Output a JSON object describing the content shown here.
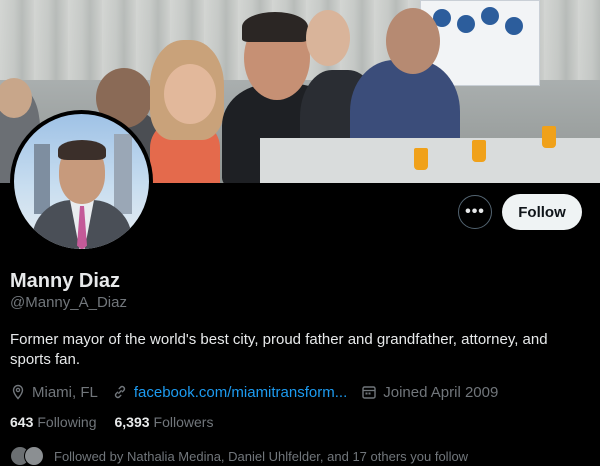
{
  "profile": {
    "name": "Manny Diaz",
    "handle": "@Manny_A_Diaz",
    "bio": "Former mayor of the world's best city, proud father and grandfather, attorney, and sports fan.",
    "location": "Miami, FL",
    "website": "facebook.com/miamitransform...",
    "joined": "Joined April 2009",
    "following_count": "643",
    "following_label": "Following",
    "followers_count": "6,393",
    "followers_label": "Followers",
    "followed_by": "Followed by Nathalia Medina, Daniel Uhlfelder, and 17 others you follow"
  },
  "actions": {
    "more_label": "•••",
    "follow_label": "Follow"
  },
  "colors": {
    "background": "#000000",
    "accent": "#1d9bf0",
    "muted": "#71767b"
  },
  "icons": [
    "more-options-icon",
    "location-icon",
    "link-icon",
    "calendar-icon"
  ]
}
